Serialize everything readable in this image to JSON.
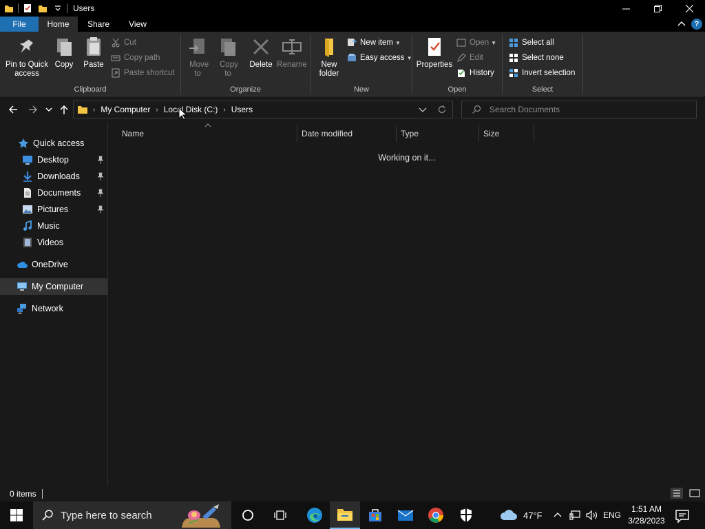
{
  "window": {
    "title": "Users",
    "controls": {
      "minimize": "─",
      "restore": "❐",
      "close": "✕"
    }
  },
  "ribbon_tabs": [
    "File",
    "Home",
    "Share",
    "View"
  ],
  "help_label": "?",
  "ribbon": {
    "clipboard": {
      "name": "Clipboard",
      "pin": "Pin to Quick access",
      "copy": "Copy",
      "paste": "Paste",
      "cut": "Cut",
      "copy_path": "Copy path",
      "paste_shortcut": "Paste shortcut"
    },
    "organize": {
      "name": "Organize",
      "move_to": "Move to",
      "copy_to": "Copy to",
      "delete": "Delete",
      "rename": "Rename"
    },
    "new": {
      "name": "New",
      "new_folder": "New folder",
      "new_item": "New item",
      "easy_access": "Easy access"
    },
    "open": {
      "name": "Open",
      "properties": "Properties",
      "open": "Open",
      "edit": "Edit",
      "history": "History"
    },
    "select": {
      "name": "Select",
      "select_all": "Select all",
      "select_none": "Select none",
      "invert_selection": "Invert selection"
    }
  },
  "address": {
    "crumbs": [
      "My Computer",
      "Local Disk (C:)",
      "Users"
    ],
    "search_placeholder": "Search Documents"
  },
  "nav": {
    "quick_access": "Quick access",
    "items": [
      {
        "label": "Desktop",
        "pinned": true
      },
      {
        "label": "Downloads",
        "pinned": true
      },
      {
        "label": "Documents",
        "pinned": true
      },
      {
        "label": "Pictures",
        "pinned": true
      },
      {
        "label": "Music",
        "pinned": false
      },
      {
        "label": "Videos",
        "pinned": false
      }
    ],
    "onedrive": "OneDrive",
    "my_computer": "My Computer",
    "network": "Network"
  },
  "columns": [
    "Name",
    "Date modified",
    "Type",
    "Size"
  ],
  "status_message": "Working on it...",
  "statusbar": {
    "count": "0 items"
  },
  "taskbar": {
    "search_placeholder": "Type here to search",
    "weather": "47°F",
    "language": "ENG",
    "time": "1:51 AM",
    "date": "3/28/2023"
  },
  "colors": {
    "accent": "#1f6fb3",
    "folder": "#f4c542",
    "background": "#191919",
    "ribbon": "#2b2b2b"
  }
}
